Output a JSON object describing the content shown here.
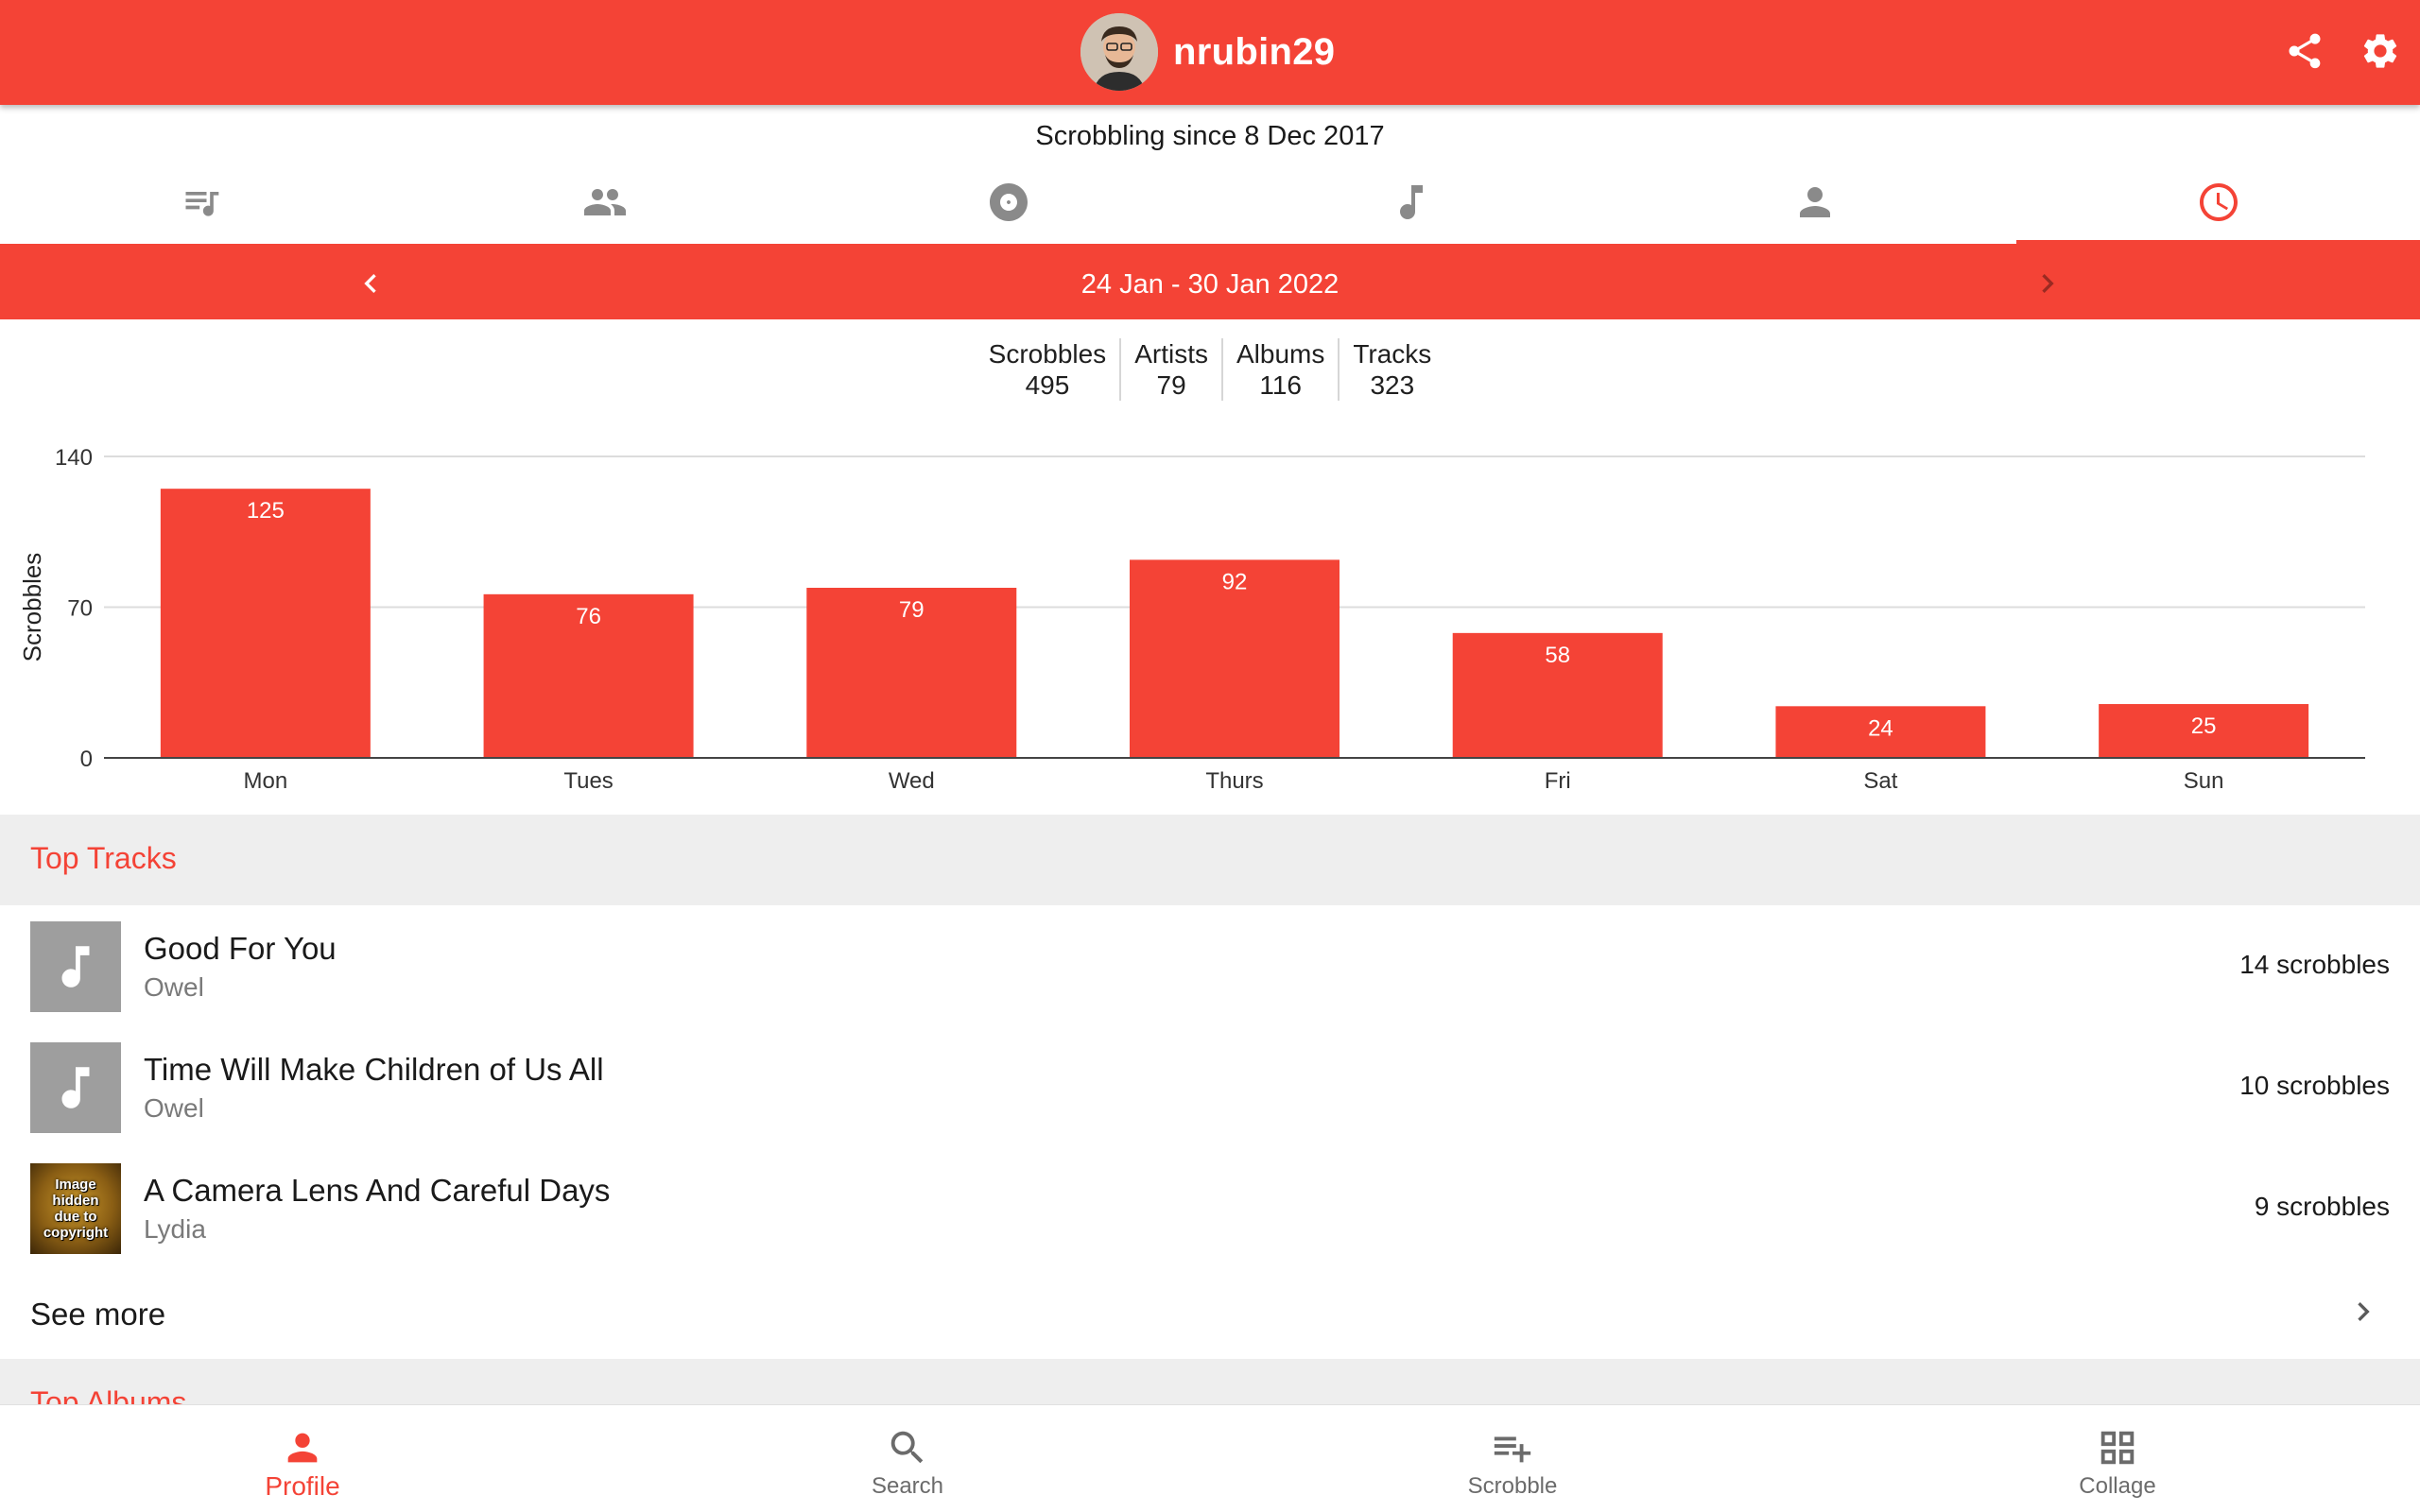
{
  "appbar": {
    "username": "nrubin29",
    "actions": [
      {
        "name": "share-icon"
      },
      {
        "name": "gear-icon"
      }
    ],
    "colors": {
      "primary": "#f44336",
      "on_primary": "#ffffff"
    }
  },
  "profile": {
    "scrobbling_since": "Scrobbling since 8 Dec 2017"
  },
  "tabs": [
    {
      "icon": "queue-music-icon",
      "active": false
    },
    {
      "icon": "people-icon",
      "active": false
    },
    {
      "icon": "album-icon",
      "active": false
    },
    {
      "icon": "music-note-icon",
      "active": false
    },
    {
      "icon": "person-icon",
      "active": false
    },
    {
      "icon": "clock-icon",
      "active": true
    }
  ],
  "range": {
    "label": "24 Jan - 30 Jan 2022",
    "prev_icon": "chevron-left-icon",
    "next_icon": "chevron-right-icon"
  },
  "stats": [
    {
      "label": "Scrobbles",
      "value": "495"
    },
    {
      "label": "Artists",
      "value": "79"
    },
    {
      "label": "Albums",
      "value": "116"
    },
    {
      "label": "Tracks",
      "value": "323"
    }
  ],
  "chart_data": {
    "type": "bar",
    "categories": [
      "Mon",
      "Tues",
      "Wed",
      "Thurs",
      "Fri",
      "Sat",
      "Sun"
    ],
    "values": [
      125,
      76,
      79,
      92,
      58,
      24,
      25
    ],
    "ylabel": "Scrobbles",
    "xlabel": "",
    "ylim": [
      0,
      140
    ],
    "yticks": [
      0,
      70,
      140
    ],
    "grid": true,
    "bar_color": "#f44336",
    "data_labels": true
  },
  "top_tracks": {
    "title": "Top Tracks",
    "items": [
      {
        "title": "Good For You",
        "artist": "Owel",
        "count": "14 scrobbles",
        "art": "placeholder"
      },
      {
        "title": "Time Will Make Children of Us All",
        "artist": "Owel",
        "count": "10 scrobbles",
        "art": "placeholder"
      },
      {
        "title": "A Camera Lens And Careful Days",
        "artist": "Lydia",
        "count": "9 scrobbles",
        "art": "copyright",
        "art_text": [
          "Image",
          "hidden",
          "due to",
          "copyright"
        ]
      }
    ],
    "see_more": "See more"
  },
  "top_albums": {
    "title": "Top Albums"
  },
  "bottom_nav": [
    {
      "label": "Profile",
      "icon": "person-icon",
      "active": true
    },
    {
      "label": "Search",
      "icon": "search-icon",
      "active": false
    },
    {
      "label": "Scrobble",
      "icon": "playlist-add-icon",
      "active": false
    },
    {
      "label": "Collage",
      "icon": "grid-icon",
      "active": false
    }
  ]
}
